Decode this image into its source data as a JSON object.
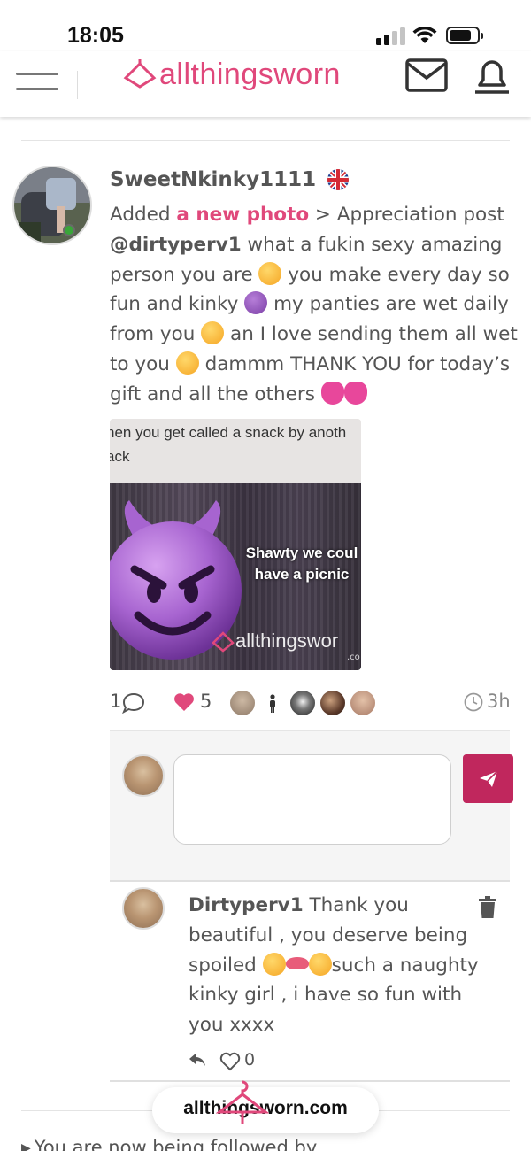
{
  "status_bar": {
    "time": "18:05"
  },
  "header": {
    "logo_text": "allthingsworn",
    "brand_color": "#e0487b"
  },
  "post": {
    "author": "SweetNkinky1111",
    "flag": "uk-flag-icon",
    "action_prefix": "Added ",
    "action_link": "a new photo",
    "after_link": " > Appreciation post",
    "mention": "@dirtyperv1",
    "body_1": " what a fukin sexy amazing person you are ",
    "body_2": " you make every day so fun and kinky ",
    "body_3": " my panties are wet daily from you ",
    "body_4": " an I love sending them all wet to you ",
    "body_5": " dammm THANK YOU for today’s gift and all the others ",
    "image": {
      "caption": "hen you get called a snack by anoth\nack",
      "overlay": "Shawty we coul\nhave a picnic",
      "watermark": "allthingswor",
      "watermark_small": ".co"
    },
    "comments_count": "1",
    "likes_count": "5",
    "time_ago": "3h"
  },
  "reply": {
    "author": "Dirtyperv1",
    "text_1": " Thank you beautiful , you deserve being spoiled ",
    "text_2": "such a naughty kinky girl , i have so fun with you xxxx",
    "likes": "0"
  },
  "next_item": "You are now being followed by",
  "url_bar": {
    "url": "allthingsworn.com"
  },
  "colors": {
    "send_button": "#c0275d",
    "heart": "#e0487b",
    "text": "#555555"
  }
}
